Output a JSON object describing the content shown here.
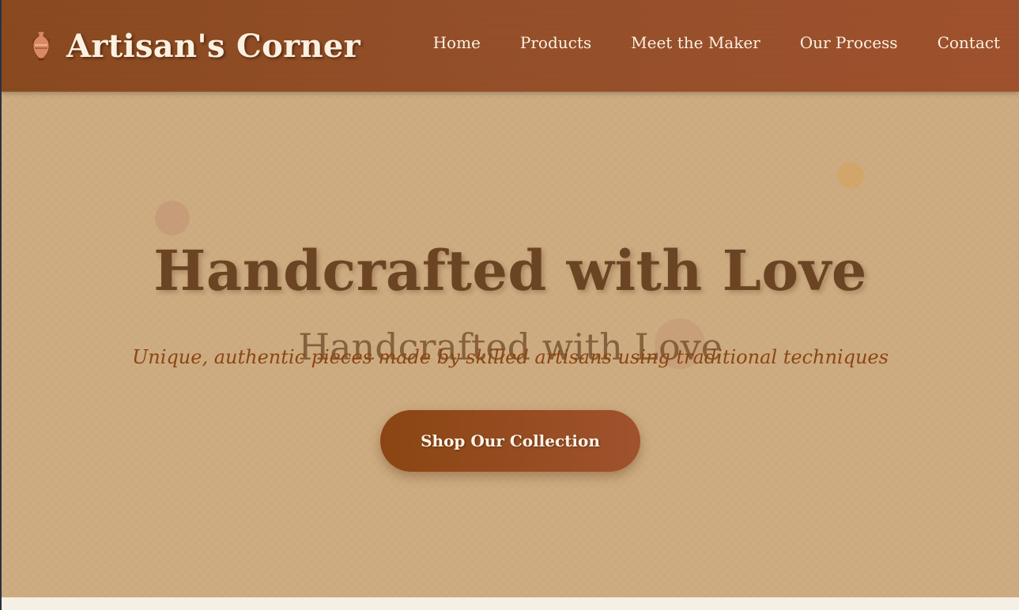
{
  "header": {
    "brand_icon": "amphora-vase-icon",
    "brand_name": "Artisan's Corner",
    "nav": [
      {
        "label": "Home"
      },
      {
        "label": "Products"
      },
      {
        "label": "Meet the Maker"
      },
      {
        "label": "Our Process"
      },
      {
        "label": "Contact"
      }
    ]
  },
  "hero": {
    "title": "Handcrafted with Love",
    "ghost_title": "Handcrafted with Love",
    "subtitle": "Unique, authentic pieces made by skilled artisans using traditional techniques",
    "cta_label": "Shop Our Collection"
  },
  "colors": {
    "header_bg": "#8b4a1f",
    "hero_bg": "#cdab80",
    "title": "#6b4423",
    "subtitle": "#8b4513",
    "button_bg": "#8b4513",
    "light_text": "#fbf1e2"
  }
}
